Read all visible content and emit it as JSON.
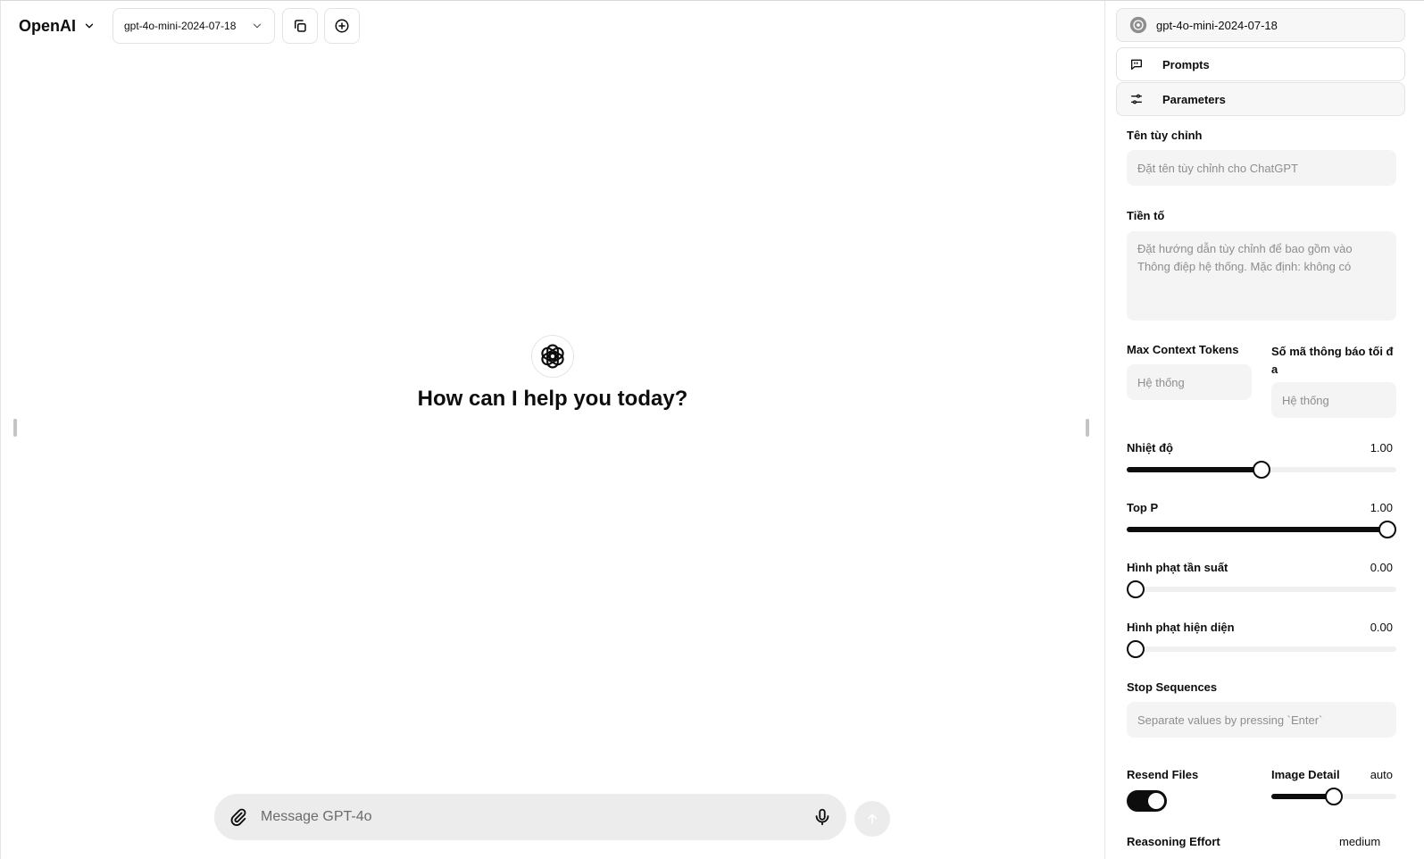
{
  "header": {
    "brand": "OpenAI",
    "model_select": "gpt-4o-mini-2024-07-18"
  },
  "hero": {
    "title": "How can I help you today?"
  },
  "composer": {
    "placeholder": "Message GPT-4o"
  },
  "panel": {
    "model_label": "gpt-4o-mini-2024-07-18",
    "prompts_label": "Prompts",
    "parameters_label": "Parameters",
    "custom_name": {
      "label": "Tên tùy chỉnh",
      "placeholder": "Đặt tên tùy chỉnh cho ChatGPT"
    },
    "prefix": {
      "label": "Tiền tố",
      "placeholder": "Đặt hướng dẫn tùy chỉnh để bao gồm vào Thông điệp hệ thống. Mặc định: không có"
    },
    "max_context_tokens": {
      "label": "Max Context Tokens",
      "placeholder": "Hệ thống"
    },
    "max_output_tokens": {
      "label": "Số mã thông báo tối đa",
      "placeholder": "Hệ thống"
    },
    "temperature": {
      "label": "Nhiệt độ",
      "value": "1.00",
      "fraction": 0.5
    },
    "top_p": {
      "label": "Top P",
      "value": "1.00",
      "fraction": 1.0
    },
    "frequency_penalty": {
      "label": "Hình phạt tần suất",
      "value": "0.00",
      "fraction": 0.0
    },
    "presence_penalty": {
      "label": "Hình phạt hiện diện",
      "value": "0.00",
      "fraction": 0.0
    },
    "stop_sequences": {
      "label": "Stop Sequences",
      "placeholder": "Separate values by pressing `Enter`"
    },
    "resend_files": {
      "label": "Resend Files",
      "enabled": true
    },
    "image_detail": {
      "label": "Image Detail",
      "value": "auto",
      "fraction": 0.5
    },
    "reasoning_effort": {
      "label": "Reasoning Effort",
      "value": "medium"
    }
  }
}
